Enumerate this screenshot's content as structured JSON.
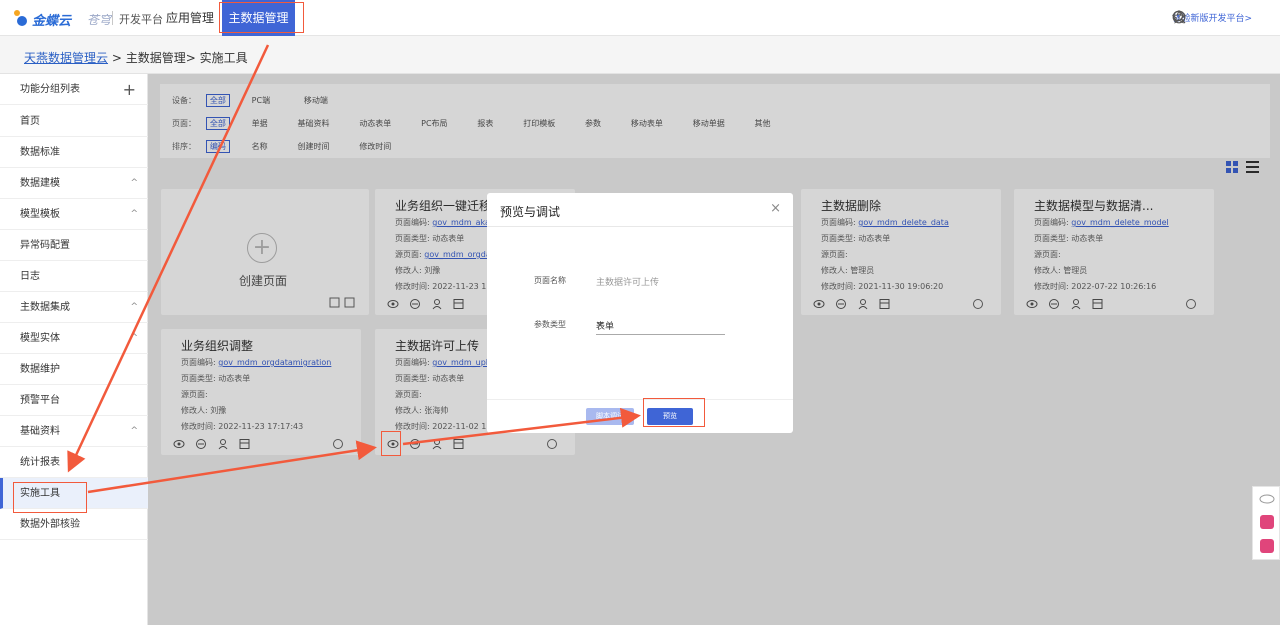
{
  "brand": {
    "name": "金蝶云",
    "sub": "苍穹",
    "dev": "开发平台"
  },
  "top_nav": {
    "app": "应用管理",
    "mdm": "主数据管理"
  },
  "top_right": {
    "tryout": "体验新版开发平台>",
    "icons": [
      "search-icon",
      "star-icon",
      "help-icon"
    ]
  },
  "breadcrumb": {
    "root": "天燕数据管理云",
    "sep1": ">",
    "mid": "主数据管理",
    "sep2": ">",
    "current": "实施工具"
  },
  "sidebar": {
    "header": "功能分组列表",
    "plus": "+",
    "items": [
      {
        "label": "首页",
        "chev": ""
      },
      {
        "label": "数据标准",
        "chev": ""
      },
      {
        "label": "数据建模",
        "chev": "^"
      },
      {
        "label": "模型模板",
        "chev": "^"
      },
      {
        "label": "异常码配置",
        "chev": ""
      },
      {
        "label": "日志",
        "chev": ""
      },
      {
        "label": "主数据集成",
        "chev": "^"
      },
      {
        "label": "模型实体",
        "chev": "^"
      },
      {
        "label": "数据维护",
        "chev": ""
      },
      {
        "label": "预警平台",
        "chev": ""
      },
      {
        "label": "基础资料",
        "chev": "^"
      },
      {
        "label": "统计报表",
        "chev": ""
      },
      {
        "label": "实施工具",
        "chev": ""
      },
      {
        "label": "数据外部核验",
        "chev": ""
      }
    ]
  },
  "filter": {
    "device_label": "设备：",
    "device_opts": [
      "全部",
      "PC端",
      "移动端"
    ],
    "page_label": "页面：",
    "page_opts": [
      "全部",
      "单据",
      "基础资料",
      "动态表单",
      "PC布局",
      "报表",
      "打印模板",
      "参数",
      "移动表单",
      "移动单据",
      "其他"
    ],
    "sort_label": "排序：",
    "sort_opts": [
      "编码",
      "名称",
      "创建时间",
      "修改时间"
    ]
  },
  "create_card": {
    "label": "创建页面",
    "plus": "+"
  },
  "cards": [
    {
      "title": "业务组织一键迁移",
      "code_label": "页面编码:",
      "code": "gov_mdm_aka",
      "type_label": "页面类型:",
      "type": "动态表单",
      "src_label": "源页面:",
      "src": "gov_mdm_orgdat",
      "mod_label": "修改人:",
      "mod": "刘豫",
      "time_label": "修改时间:",
      "time": "2022-11-23 17:"
    },
    {
      "title": "主数据删除",
      "code_label": "页面编码:",
      "code": "gov_mdm_delete_data",
      "type_label": "页面类型:",
      "type": "动态表单",
      "src_label": "源页面:",
      "src": "",
      "mod_label": "修改人:",
      "mod": "管理员",
      "time_label": "修改时间:",
      "time": "2021-11-30 19:06:20"
    },
    {
      "title": "主数据模型与数据清...",
      "code_label": "页面编码:",
      "code": "gov_mdm_delete_model",
      "type_label": "页面类型:",
      "type": "动态表单",
      "src_label": "源页面:",
      "src": "",
      "mod_label": "修改人:",
      "mod": "管理员",
      "time_label": "修改时间:",
      "time": "2022-07-22 10:26:16"
    },
    {
      "title": "业务组织调整",
      "code_label": "页面编码:",
      "code": "gov_mdm_orgdatamigration",
      "type_label": "页面类型:",
      "type": "动态表单",
      "src_label": "源页面:",
      "src": "",
      "mod_label": "修改人:",
      "mod": "刘豫",
      "time_label": "修改时间:",
      "time": "2022-11-23 17:17:43"
    },
    {
      "title": "主数据许可上传",
      "code_label": "页面编码:",
      "code": "gov_mdm_uplo",
      "type_label": "页面类型:",
      "type": "动态表单",
      "src_label": "源页面:",
      "src": "",
      "mod_label": "修改人:",
      "mod": "张海帅",
      "time_label": "修改时间:",
      "time": "2022-11-02 17"
    }
  ],
  "dialog": {
    "title": "预览与调试",
    "close": "×",
    "name_label": "页面名称",
    "name_value": "主数据许可上传",
    "type_label": "参数类型",
    "type_value": "表单",
    "script_btn": "脚本调试",
    "preview_btn": "预览"
  },
  "colors": {
    "accent": "#3f65d6",
    "annotation": "#f25a3c"
  }
}
